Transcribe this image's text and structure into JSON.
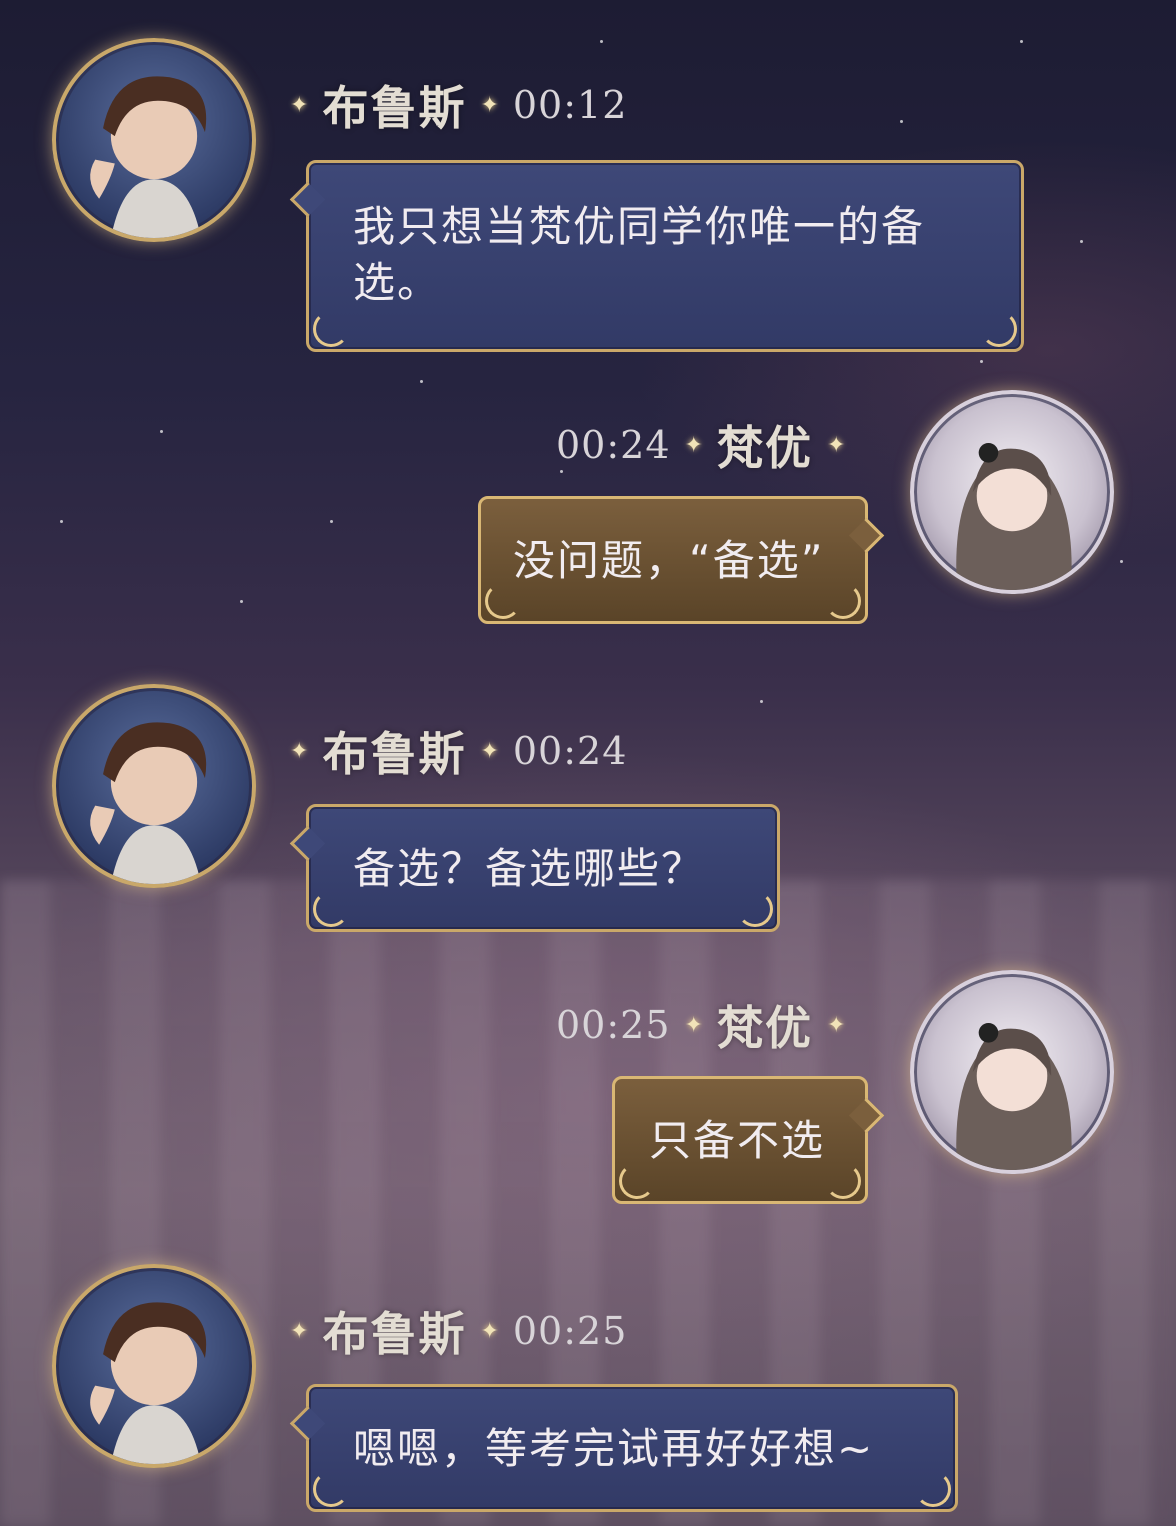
{
  "colors": {
    "blue_bubble": "#3e4878",
    "gold_bubble": "#7b5f3d",
    "frame_gold": "#caa869"
  },
  "messages": [
    {
      "sender": "布鲁斯",
      "time": "00:12",
      "text": "我只想当梵优同学你唯一的备选。",
      "side": "left",
      "avatar_icon": "bruce-avatar"
    },
    {
      "sender": "梵优",
      "time": "00:24",
      "text": "没问题，“备选”",
      "side": "right",
      "avatar_icon": "fanyou-avatar"
    },
    {
      "sender": "布鲁斯",
      "time": "00:24",
      "text": "备选？备选哪些？",
      "side": "left",
      "avatar_icon": "bruce-avatar"
    },
    {
      "sender": "梵优",
      "time": "00:25",
      "text": "只备不选",
      "side": "right",
      "avatar_icon": "fanyou-avatar"
    },
    {
      "sender": "布鲁斯",
      "time": "00:25",
      "text": "嗯嗯，等考完试再好好想~",
      "side": "left",
      "avatar_icon": "bruce-avatar"
    }
  ]
}
